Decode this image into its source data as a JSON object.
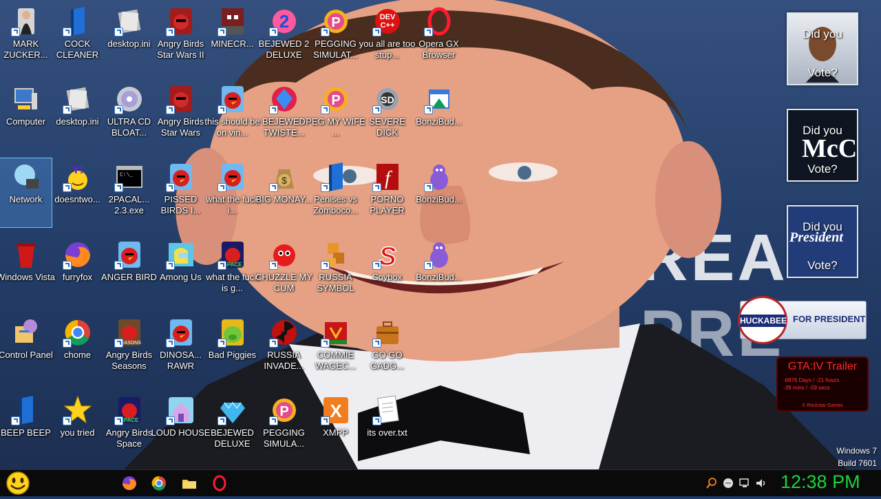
{
  "desktop": {
    "icons": [
      {
        "label": "MARK ZUCKER...",
        "icon": "person-icon"
      },
      {
        "label": "COCK CLEANER",
        "icon": "blue-book-icon"
      },
      {
        "label": "desktop.ini",
        "icon": "ini-file-icon"
      },
      {
        "label": "Angry Birds Star Wars II",
        "icon": "angry-birds-starwars-icon"
      },
      {
        "label": "MINECR...",
        "icon": "minecraft-icon"
      },
      {
        "label": "BEJEWED 2 DELUXE",
        "icon": "bejeweled-icon"
      },
      {
        "label": "PEGGING SIMULAT...",
        "icon": "peggle-icon"
      },
      {
        "label": "you all are too stup...",
        "icon": "devcpp-icon"
      },
      {
        "label": "Opera GX Browser",
        "icon": "opera-icon"
      },
      {
        "label": "Computer",
        "icon": "computer-icon"
      },
      {
        "label": "desktop.ini",
        "icon": "ini-file-icon"
      },
      {
        "label": "ULTRA CD BLOAT...",
        "icon": "cd-icon"
      },
      {
        "label": "Angry Birds Star Wars",
        "icon": "angry-birds-starwars-icon"
      },
      {
        "label": "this should be on vin...",
        "icon": "angry-bird-icon"
      },
      {
        "label": "BEJEWED TWISTE...",
        "icon": "bejeweled-twist-icon"
      },
      {
        "label": "PEG MY WIFE ...",
        "icon": "peggle-icon"
      },
      {
        "label": "SEVERE DICK",
        "icon": "sd-gear-icon"
      },
      {
        "label": "BonziBud...",
        "icon": "window-icon"
      },
      {
        "label": "Network",
        "icon": "network-icon"
      },
      {
        "label": "doesntwo...",
        "icon": "yahoo-icon"
      },
      {
        "label": "2PACAL... 2.3.exe",
        "icon": "console-icon"
      },
      {
        "label": "PISSED BIRDS I...",
        "icon": "angry-bird-icon"
      },
      {
        "label": "what the fuck i...",
        "icon": "angry-bird-icon"
      },
      {
        "label": "BIG MONAY...",
        "icon": "money-bag-icon"
      },
      {
        "label": "Penises vs Zomboco...",
        "icon": "blue-book-icon"
      },
      {
        "label": "PORNO PLAYER",
        "icon": "flash-icon"
      },
      {
        "label": "BonziBud...",
        "icon": "bonzi-icon"
      },
      {
        "label": "Windows Vista",
        "icon": "recycle-bin-icon"
      },
      {
        "label": "furryfox",
        "icon": "firefox-icon"
      },
      {
        "label": "ANGER BIRD",
        "icon": "angry-bird-icon"
      },
      {
        "label": "Among Us",
        "icon": "among-us-icon"
      },
      {
        "label": "what the fuck is g...",
        "icon": "angry-birds-space-icon"
      },
      {
        "label": "CHUZZLE MY CUM",
        "icon": "chuzzle-icon"
      },
      {
        "label": "RUSSIA SYMBOL",
        "icon": "blocks-icon"
      },
      {
        "label": "Soybox",
        "icon": "soybox-icon"
      },
      {
        "label": "BonziBud...",
        "icon": "bonzi-icon"
      },
      {
        "label": "Control Panel",
        "icon": "control-panel-icon"
      },
      {
        "label": "chome",
        "icon": "chrome-icon"
      },
      {
        "label": "Angry Birds Seasons",
        "icon": "angry-birds-seasons-icon"
      },
      {
        "label": "DINOSA... RAWR",
        "icon": "angry-bird-icon"
      },
      {
        "label": "Bad Piggies",
        "icon": "pig-icon"
      },
      {
        "label": "RUSSIA INVADE...",
        "icon": "radiation-icon"
      },
      {
        "label": "COMMIE WAGEC...",
        "icon": "banner-icon"
      },
      {
        "label": "GO GO GADG...",
        "icon": "briefcase-icon"
      },
      {
        "label": "BEEP BEEP",
        "icon": "blue-book-icon"
      },
      {
        "label": "you tried",
        "icon": "star-icon"
      },
      {
        "label": "Angry Birds Space",
        "icon": "angry-birds-space-icon"
      },
      {
        "label": "LOUD HOUSE",
        "icon": "loud-house-icon"
      },
      {
        "label": "BEJEWED DELUXE",
        "icon": "diamond-icon"
      },
      {
        "label": "PEGGING SIMULA...",
        "icon": "peggle-icon"
      },
      {
        "label": "XMPP",
        "icon": "xampp-icon"
      },
      {
        "label": "its over.txt",
        "icon": "text-file-icon"
      }
    ]
  },
  "gadgets": {
    "vote1": {
      "line1": "Did you",
      "line2": "Vote?"
    },
    "vote2": {
      "line1": "Did you",
      "logo": "McC",
      "line2": "Vote?"
    },
    "vote3": {
      "line1": "Did you",
      "logo": "President",
      "line2": "Vote?"
    },
    "huckabee": {
      "name": "HUCKABEE",
      "text": "FOR PRESIDENT"
    },
    "gta": {
      "title": "GTA:IV Trailer",
      "count1": "-6876 Days / -21 hours",
      "count2": "-39 mins / -59 secs",
      "credit": "© Rockstar Games"
    }
  },
  "wallpaper": {
    "banner1": "REA",
    "banner2": "PRE"
  },
  "watermark": {
    "line1": "Windows 7",
    "line2": "Build 7601"
  },
  "taskbar": {
    "clock": "12:38 PM",
    "apps": [
      "firefox-icon",
      "chrome-icon",
      "folder-icon",
      "opera-icon"
    ],
    "tray": [
      "search-icon",
      "network-tray-icon",
      "monitor-tray-icon",
      "volume-icon"
    ]
  },
  "colors": {
    "clock": "#1dd33c",
    "gta_red": "#ff2a2a",
    "accent_blue": "#3b7fc6"
  }
}
